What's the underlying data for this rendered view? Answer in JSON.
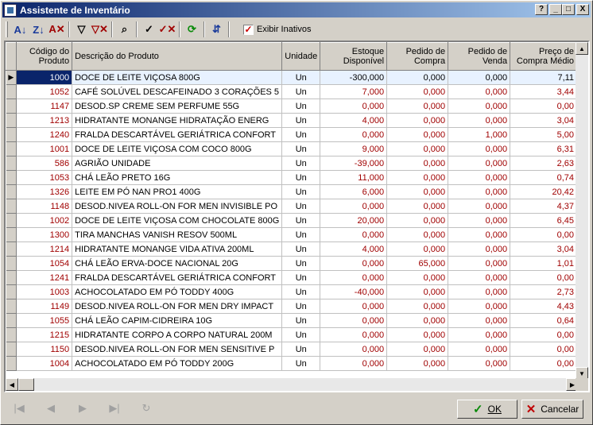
{
  "window": {
    "title": "Assistente de Inventário",
    "help_label": "?",
    "minimize_label": "_",
    "maximize_label": "□",
    "close_label": "X"
  },
  "toolbar": {
    "buttons": [
      {
        "name": "sort-ascending-icon",
        "glyph": "A↓"
      },
      {
        "name": "sort-descending-icon",
        "glyph": "Z↓"
      },
      {
        "name": "clear-sort-icon",
        "glyph": "A✕"
      },
      {
        "name": "filter-icon",
        "glyph": "▽"
      },
      {
        "name": "clear-filter-icon",
        "glyph": "▽✕"
      },
      {
        "name": "find-icon",
        "glyph": "⌕"
      },
      {
        "name": "check-icon",
        "glyph": "✓"
      },
      {
        "name": "uncheck-icon",
        "glyph": "✓✕"
      },
      {
        "name": "refresh-icon",
        "glyph": "⟳"
      },
      {
        "name": "columns-icon",
        "glyph": "⇵"
      }
    ],
    "show_inactive_label": "Exibir Inativos",
    "show_inactive_checked": "✓"
  },
  "columns": [
    {
      "key": "code",
      "label": "Código do Produto"
    },
    {
      "key": "desc",
      "label": "Descrição do Produto"
    },
    {
      "key": "unit",
      "label": "Unidade"
    },
    {
      "key": "stock",
      "label": "Estoque Disponível"
    },
    {
      "key": "po",
      "label": "Pedido de Compra"
    },
    {
      "key": "so",
      "label": "Pedido de Venda"
    },
    {
      "key": "price",
      "label": "Preço de Compra Médio"
    }
  ],
  "rows": [
    {
      "code": "1000",
      "desc": "DOCE DE LEITE VIÇOSA 800G",
      "unit": "Un",
      "stock": "-300,000",
      "po": "0,000",
      "so": "0,000",
      "price": "7,11"
    },
    {
      "code": "1052",
      "desc": "CAFÉ SOLÚVEL DESCAFEINADO 3 CORAÇÕES 5",
      "unit": "Un",
      "stock": "7,000",
      "po": "0,000",
      "so": "0,000",
      "price": "3,44"
    },
    {
      "code": "1147",
      "desc": "DESOD.SP CREME SEM PERFUME 55G",
      "unit": "Un",
      "stock": "0,000",
      "po": "0,000",
      "so": "0,000",
      "price": "0,00"
    },
    {
      "code": "1213",
      "desc": "HIDRATANTE MONANGE HIDRATAÇÃO ENERG",
      "unit": "Un",
      "stock": "4,000",
      "po": "0,000",
      "so": "0,000",
      "price": "3,04"
    },
    {
      "code": "1240",
      "desc": "FRALDA DESCARTÁVEL GERIÁTRICA CONFORT",
      "unit": "Un",
      "stock": "0,000",
      "po": "0,000",
      "so": "1,000",
      "price": "5,00"
    },
    {
      "code": "1001",
      "desc": "DOCE DE LEITE VIÇOSA COM COCO 800G",
      "unit": "Un",
      "stock": "9,000",
      "po": "0,000",
      "so": "0,000",
      "price": "6,31"
    },
    {
      "code": "586",
      "desc": "AGRIÃO UNIDADE",
      "unit": "Un",
      "stock": "-39,000",
      "po": "0,000",
      "so": "0,000",
      "price": "2,63"
    },
    {
      "code": "1053",
      "desc": "CHÁ LEÃO PRETO 16G",
      "unit": "Un",
      "stock": "11,000",
      "po": "0,000",
      "so": "0,000",
      "price": "0,74"
    },
    {
      "code": "1326",
      "desc": "LEITE EM PÓ NAN PRO1 400G",
      "unit": "Un",
      "stock": "6,000",
      "po": "0,000",
      "so": "0,000",
      "price": "20,42"
    },
    {
      "code": "1148",
      "desc": "DESOD.NIVEA ROLL-ON FOR MEN INVISIBLE PO",
      "unit": "Un",
      "stock": "0,000",
      "po": "0,000",
      "so": "0,000",
      "price": "4,37"
    },
    {
      "code": "1002",
      "desc": "DOCE DE LEITE VIÇOSA COM CHOCOLATE 800G",
      "unit": "Un",
      "stock": "20,000",
      "po": "0,000",
      "so": "0,000",
      "price": "6,45"
    },
    {
      "code": "1300",
      "desc": "TIRA MANCHAS VANISH RESOV 500ML",
      "unit": "Un",
      "stock": "0,000",
      "po": "0,000",
      "so": "0,000",
      "price": "0,00"
    },
    {
      "code": "1214",
      "desc": "HIDRATANTE MONANGE VIDA ATIVA 200ML",
      "unit": "Un",
      "stock": "4,000",
      "po": "0,000",
      "so": "0,000",
      "price": "3,04"
    },
    {
      "code": "1054",
      "desc": "CHÁ LEÃO ERVA-DOCE NACIONAL 20G",
      "unit": "Un",
      "stock": "0,000",
      "po": "65,000",
      "so": "0,000",
      "price": "1,01"
    },
    {
      "code": "1241",
      "desc": "FRALDA DESCARTÁVEL GERIÁTRICA CONFORT",
      "unit": "Un",
      "stock": "0,000",
      "po": "0,000",
      "so": "0,000",
      "price": "0,00"
    },
    {
      "code": "1003",
      "desc": "ACHOCOLATADO EM PÓ TODDY 400G",
      "unit": "Un",
      "stock": "-40,000",
      "po": "0,000",
      "so": "0,000",
      "price": "2,73"
    },
    {
      "code": "1149",
      "desc": "DESOD.NIVEA ROLL-ON FOR MEN DRY IMPACT",
      "unit": "Un",
      "stock": "0,000",
      "po": "0,000",
      "so": "0,000",
      "price": "4,43"
    },
    {
      "code": "1055",
      "desc": "CHÁ LEÃO CAPIM-CIDREIRA 10G",
      "unit": "Un",
      "stock": "0,000",
      "po": "0,000",
      "so": "0,000",
      "price": "0,64"
    },
    {
      "code": "1215",
      "desc": "HIDRATANTE CORPO A CORPO NATURAL 200M",
      "unit": "Un",
      "stock": "0,000",
      "po": "0,000",
      "so": "0,000",
      "price": "0,00"
    },
    {
      "code": "1150",
      "desc": "DESOD.NIVEA ROLL-ON FOR MEN SENSITIVE P",
      "unit": "Un",
      "stock": "0,000",
      "po": "0,000",
      "so": "0,000",
      "price": "0,00"
    },
    {
      "code": "1004",
      "desc": "ACHOCOLATADO EM PÓ TODDY 200G",
      "unit": "Un",
      "stock": "0,000",
      "po": "0,000",
      "so": "0,000",
      "price": "0,00"
    }
  ],
  "selected_row": 0,
  "navigator": [
    "|◀",
    "◀",
    "▶",
    "▶|",
    "↻"
  ],
  "buttons": {
    "ok_label": "OK",
    "cancel_label": "Cancelar"
  }
}
